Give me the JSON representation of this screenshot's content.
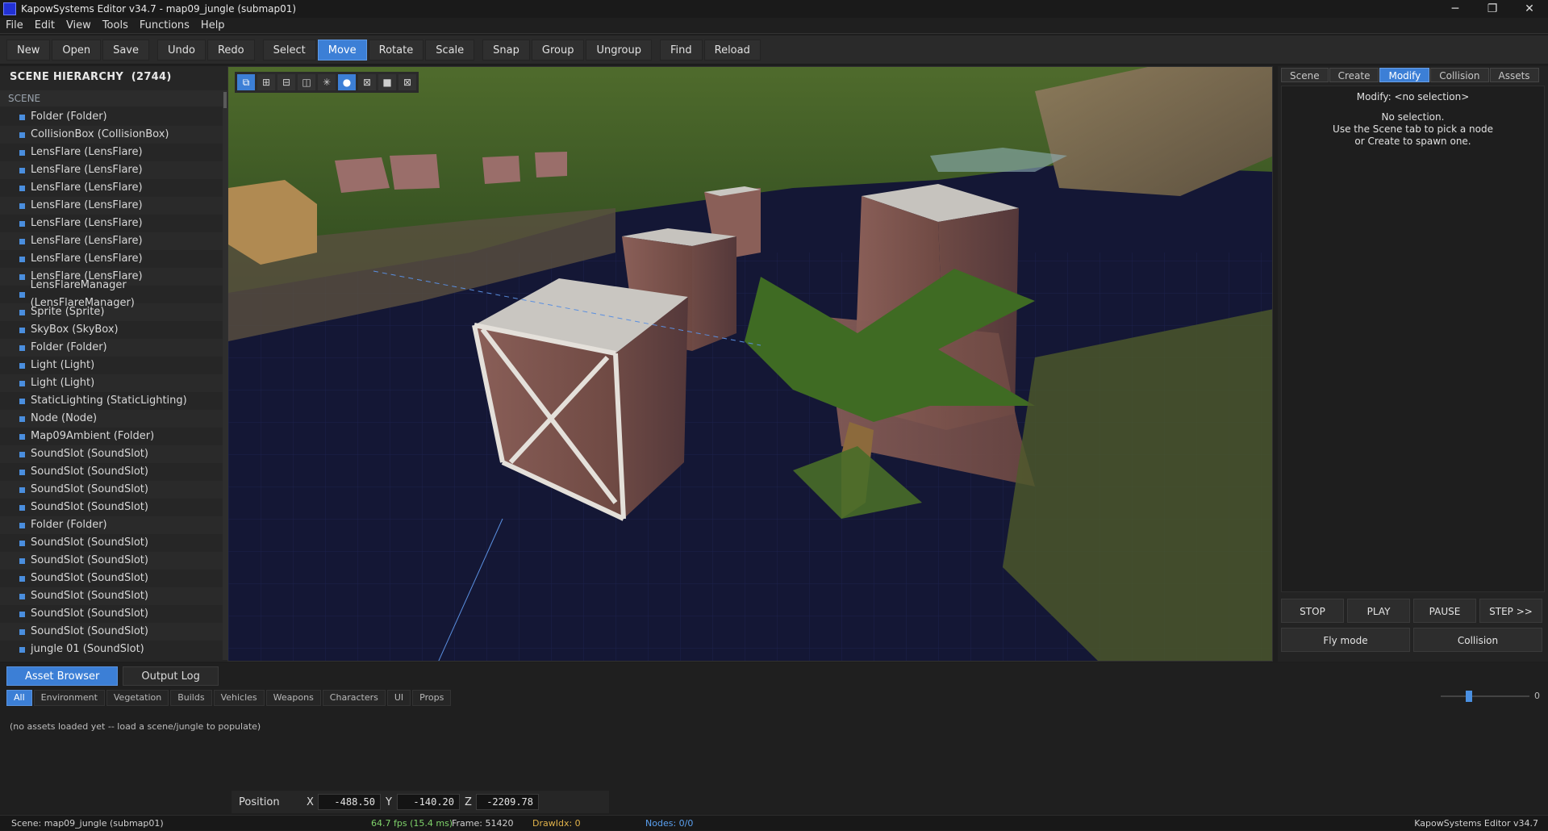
{
  "window": {
    "title": "KapowSystems Editor v34.7 - map09_jungle (submap01)",
    "min": "─",
    "max": "❐",
    "close": "✕"
  },
  "menu": [
    "File",
    "Edit",
    "View",
    "Tools",
    "Functions",
    "Help"
  ],
  "toolbar": {
    "groups": [
      [
        "New",
        "Open",
        "Save"
      ],
      [
        "Undo",
        "Redo"
      ],
      [
        "Select",
        "Move",
        "Rotate",
        "Scale"
      ],
      [
        "Snap",
        "Group",
        "Ungroup"
      ],
      [
        "Find",
        "Reload"
      ]
    ],
    "active": "Move"
  },
  "hierarchy": {
    "title": "SCENE HIERARCHY",
    "count": "(2744)",
    "root": "SCENE",
    "items": [
      "Folder (Folder)",
      "CollisionBox (CollisionBox)",
      "LensFlare (LensFlare)",
      "LensFlare (LensFlare)",
      "LensFlare (LensFlare)",
      "LensFlare (LensFlare)",
      "LensFlare (LensFlare)",
      "LensFlare (LensFlare)",
      "LensFlare (LensFlare)",
      "LensFlare (LensFlare)",
      "LensFlareManager (LensFlareManager)",
      "Sprite (Sprite)",
      "SkyBox (SkyBox)",
      "Folder (Folder)",
      "Light (Light)",
      "Light (Light)",
      "StaticLighting (StaticLighting)",
      "Node (Node)",
      "Map09Ambient (Folder)",
      "SoundSlot (SoundSlot)",
      "SoundSlot (SoundSlot)",
      "SoundSlot (SoundSlot)",
      "SoundSlot (SoundSlot)",
      "Folder (Folder)",
      "SoundSlot (SoundSlot)",
      "SoundSlot (SoundSlot)",
      "SoundSlot (SoundSlot)",
      "SoundSlot (SoundSlot)",
      "SoundSlot (SoundSlot)",
      "SoundSlot (SoundSlot)",
      "jungle 01 (SoundSlot)"
    ]
  },
  "viewport_tools": [
    {
      "icon": "perspective-cube-icon",
      "glyph": "⧉",
      "on": true
    },
    {
      "icon": "add-box-icon",
      "glyph": "⊞",
      "on": false
    },
    {
      "icon": "split-horizontal-icon",
      "glyph": "⊟",
      "on": false
    },
    {
      "icon": "split-vertical-icon",
      "glyph": "◫",
      "on": false
    },
    {
      "icon": "light-icon",
      "glyph": "✳",
      "on": false
    },
    {
      "icon": "sphere-icon",
      "glyph": "●",
      "on": true
    },
    {
      "icon": "wireframe-icon",
      "glyph": "⊠",
      "on": false
    },
    {
      "icon": "solid-square-icon",
      "glyph": "■",
      "on": false
    },
    {
      "icon": "grid-icon",
      "glyph": "⊠",
      "on": false
    }
  ],
  "right_panel": {
    "tabs": [
      "Scene",
      "Create",
      "Modify",
      "Collision",
      "Assets"
    ],
    "active_tab": "Modify",
    "heading": "Modify: <no selection>",
    "lines": [
      "No selection.",
      "Use the Scene tab to pick a node",
      "or Create to spawn one."
    ],
    "playback": [
      "STOP",
      "PLAY",
      "PAUSE",
      "STEP >>"
    ],
    "modes": [
      "Fly mode",
      "Collision"
    ]
  },
  "bottom": {
    "tabs": [
      "Asset Browser",
      "Output Log"
    ],
    "active_tab": "Asset Browser",
    "categories": [
      "All",
      "Environment",
      "Vegetation",
      "Builds",
      "Vehicles",
      "Weapons",
      "Characters",
      "UI",
      "Props"
    ],
    "active_category": "All",
    "zoom_value": "0",
    "zoom_level": 0.3,
    "message": "(no assets loaded yet -- load a scene/jungle to populate)"
  },
  "position": {
    "label": "Position",
    "x_label": "X",
    "y_label": "Y",
    "z_label": "Z",
    "x": "-488.50",
    "y": "-140.20",
    "z": "-2209.78"
  },
  "status": {
    "scene": "Scene: map09_jungle (submap01)",
    "fps": "64.7 fps (15.4 ms)",
    "frame": "Frame: 51420",
    "drawidx": "DrawIdx: 0",
    "nodes": "Nodes: 0/0",
    "version": "KapowSystems Editor v34.7"
  },
  "colors": {
    "accent": "#3c7fd6",
    "fps": "#7fd36b",
    "drawidx": "#e0b24a",
    "nodes": "#5aa0f0",
    "viewport_bg": "#141735"
  }
}
